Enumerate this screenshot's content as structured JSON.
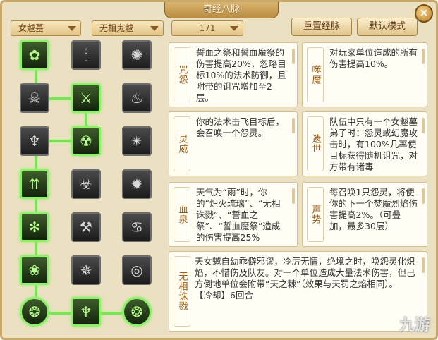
{
  "window": {
    "title": "奇经八脉",
    "close": "×"
  },
  "toolbar": {
    "school": "女魃墓",
    "faction": "无相鬼魃",
    "level": "171",
    "reset_label": "重置经脉",
    "default_label": "默认模式"
  },
  "nodes": [
    {
      "icon": "leaf-spirit-icon"
    },
    {
      "icon": "candle-icon"
    },
    {
      "icon": "swirl-wind-icon"
    },
    {
      "icon": "skull-mask-icon"
    },
    {
      "icon": "blade-icon"
    },
    {
      "icon": "flame-face-icon"
    },
    {
      "icon": "fire-icon"
    },
    {
      "icon": "ghost-skull-icon"
    },
    {
      "icon": "torn-mask-icon"
    },
    {
      "icon": "pillar-light-icon"
    },
    {
      "icon": "demon-face-icon"
    },
    {
      "icon": "dark-flame-icon"
    },
    {
      "icon": "splash-icon"
    },
    {
      "icon": "crossed-swords-icon"
    },
    {
      "icon": "twin-flame-icon"
    },
    {
      "icon": "bloom-icon"
    },
    {
      "icon": "spiral-tendril-icon"
    },
    {
      "icon": "vortex-icon"
    },
    {
      "icon": "green-orb-left-icon"
    },
    {
      "icon": "green-fire-icon"
    },
    {
      "icon": "green-orb-right-icon"
    }
  ],
  "cards": [
    {
      "label": "咒怨",
      "text": "誓血之祭和誓血魔祭的伤害提高20%，忽略目标10%的法术防御，且附带的诅咒增加至2层。"
    },
    {
      "label": "噬魔",
      "text": "对玩家单位造成的所有伤害提高10%。"
    },
    {
      "label": "灵威",
      "text": "你的法术击飞目标后，会召唤一个怨灵。"
    },
    {
      "label": "遗世",
      "text": "队伍中只有一个女魃墓弟子时：怨灵或幻魔攻击时，有100%几率使目标获得随机诅咒，对方带有诸毒"
    },
    {
      "label": "血泉",
      "text": "天气为“雨”时，你的“炽火琉璃”、“无相诛戮”、“誓血之祭”、“誓血魔祭”造成的伤害提高25%"
    },
    {
      "label": "声势",
      "text": "每召唤1只怨灵，将使你的下一个焚魔烈焰伤害提高2%。（可叠加，最多30层）"
    },
    {
      "label": "无相诛戮",
      "text": "天女魃自幼乖僻邪谬，冷厉无情，绝境之时，唤怨灵化炽焰，不惜伤及队友。对一个单位造成大量法术伤害，但己方倒地单位会附带“天之棘”（效果与天罚之焰相同）。\n【冷却】6回合"
    }
  ],
  "watermark": "九游",
  "colors": {
    "active_border": "#8cf068",
    "accent": "#9a5a12",
    "panel": "#ece0c3"
  }
}
